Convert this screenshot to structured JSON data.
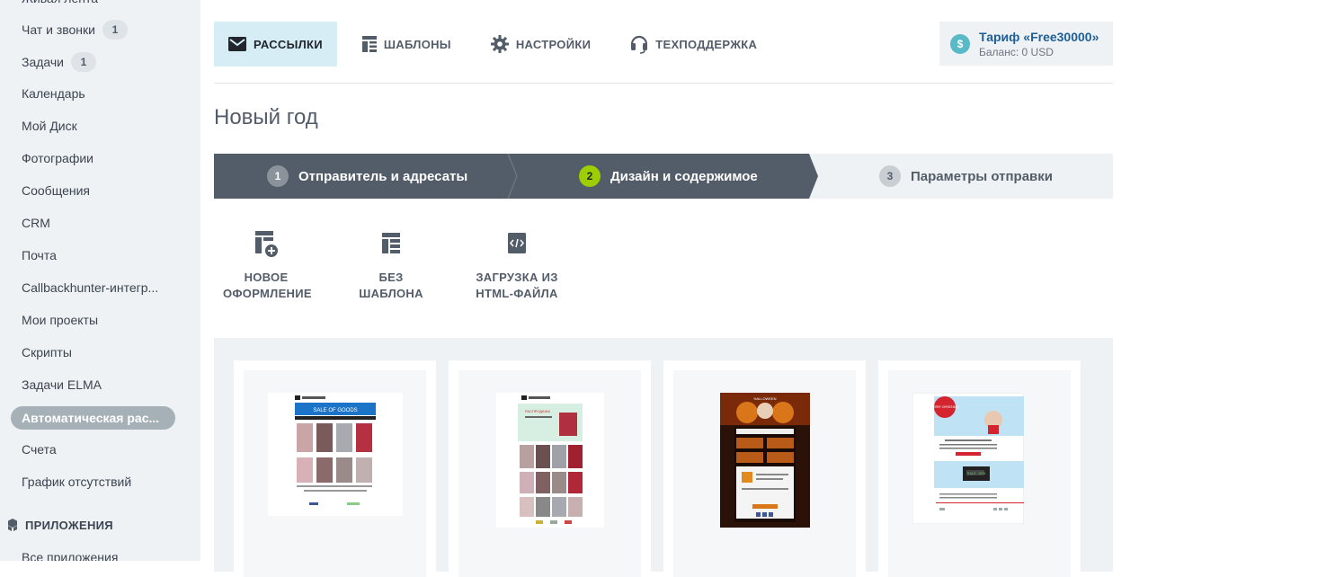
{
  "sidebar": {
    "items": [
      {
        "label": "Чат и звонки",
        "counter": "1"
      },
      {
        "label": "Задачи",
        "counter": "1"
      },
      {
        "label": "Календарь"
      },
      {
        "label": "Мой Диск"
      },
      {
        "label": "Фотографии"
      },
      {
        "label": "Сообщения"
      },
      {
        "label": "CRM"
      },
      {
        "label": "Почта"
      },
      {
        "label": "Callbackhunter-интегр..."
      },
      {
        "label": "Мои проекты"
      },
      {
        "label": "Скрипты"
      },
      {
        "label": "Задачи ELMA"
      },
      {
        "label": "Автоматическая рас..."
      },
      {
        "label": "Счета"
      },
      {
        "label": "График отсутствий"
      }
    ],
    "section_label": "ПРИЛОЖЕНИЯ",
    "section_icon": "cubes-icon",
    "next_item": "Все приложения"
  },
  "tabs": [
    {
      "label": "РАССЫЛКИ",
      "icon": "envelope-icon",
      "active": true
    },
    {
      "label": "ШАБЛОНЫ",
      "icon": "template-icon"
    },
    {
      "label": "НАСТРОЙКИ",
      "icon": "gear-icon"
    },
    {
      "label": "ТЕХПОДДЕРЖКА",
      "icon": "headset-icon"
    }
  ],
  "tariff": {
    "icon": "dollar-icon",
    "symbol": "$",
    "title": "Тариф «Free30000»",
    "balance": "Баланс: 0 USD"
  },
  "page_title": "Новый год",
  "steps": [
    {
      "num": "1",
      "label": "Отправитель и адресаты",
      "state": "done"
    },
    {
      "num": "2",
      "label": "Дизайн и содержимое",
      "state": "current"
    },
    {
      "num": "3",
      "label": "Параметры отправки",
      "state": "pending"
    }
  ],
  "colors": {
    "step_dark": "#535c69",
    "step_current_badge": "#9dcf00",
    "step_light": "#eef2f4",
    "active_tab": "#d6edf6",
    "tariff_link": "#1d5f96"
  },
  "options": [
    {
      "line1": "НОВОЕ",
      "line2": "ОФОРМЛЕНИЕ",
      "icon": "new-design-icon"
    },
    {
      "line1": "БЕЗ",
      "line2": "ШАБЛОНА",
      "icon": "no-template-icon"
    },
    {
      "line1": "ЗАГРУЗКА ИЗ",
      "line2": "HTML-ФАЙЛА",
      "icon": "html-code-icon"
    }
  ],
  "templates": [
    {
      "banner": "SALE OF GOODS"
    },
    {
      "banner": "РАСПРОДАЖА"
    },
    {
      "banner": "HALLOWEEN"
    },
    {
      "banner": "MERRY CHRISTMAS",
      "sale": "SALE -30%"
    }
  ]
}
